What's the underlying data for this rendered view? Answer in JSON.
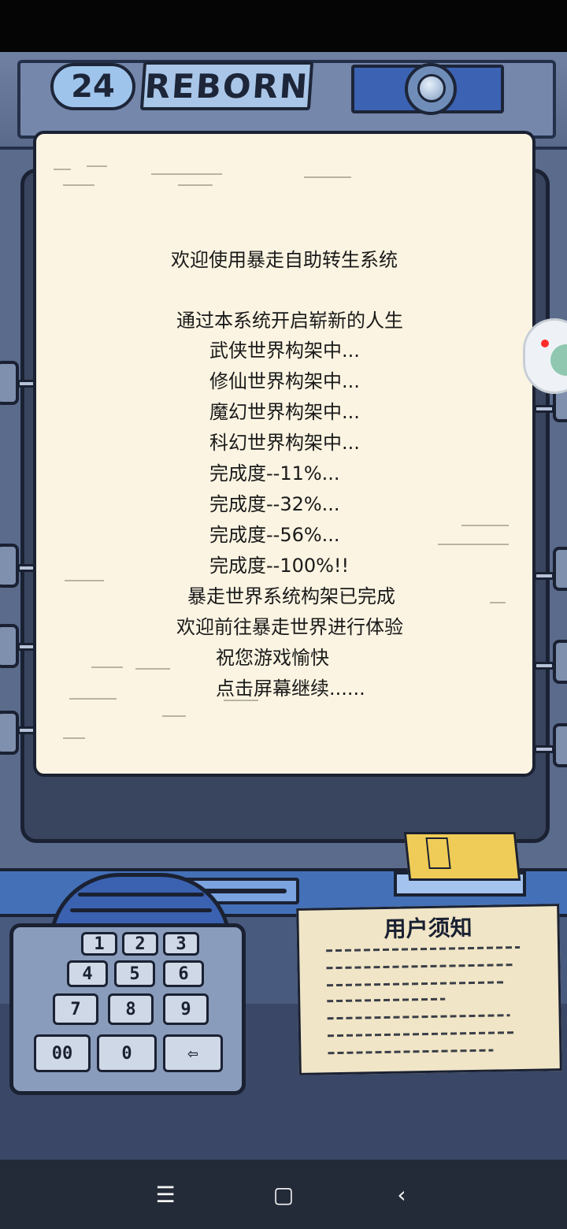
{
  "header": {
    "level_number": "24",
    "brand_word": "REBORN"
  },
  "screen": {
    "welcome": "欢迎使用暴走自助转生系统",
    "lines": [
      "通过本系统开启崭新的人生",
      "武侠世界构架中...",
      "修仙世界构架中...",
      "魔幻世界构架中...",
      "科幻世界构架中...",
      "完成度--11%...",
      "完成度--32%...",
      "完成度--56%...",
      "完成度--100%!!",
      "暴走世界系统构架已完成",
      "欢迎前往暴走世界进行体验",
      "祝您游戏愉快",
      "点击屏幕继续......"
    ]
  },
  "keypad": {
    "keys": [
      "1",
      "2",
      "3",
      "4",
      "5",
      "6",
      "7",
      "8",
      "9",
      "00",
      "0",
      "⇦"
    ]
  },
  "notice": {
    "title": "用户须知"
  },
  "navbar": {
    "menu": "☰",
    "home": "▢",
    "back": "‹"
  }
}
